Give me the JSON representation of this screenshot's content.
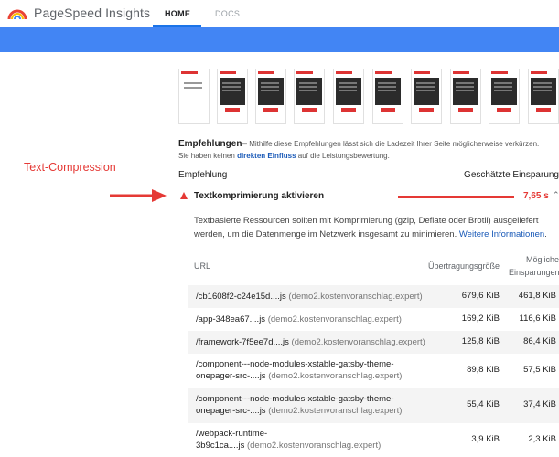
{
  "app": {
    "brand": "PageSpeed Insights",
    "tabs": [
      {
        "label": "HOME",
        "active": true
      },
      {
        "label": "DOCS",
        "active": false
      }
    ],
    "accent_color": "#4285f4"
  },
  "annotation": {
    "label": "Text-Compression",
    "color": "#e53935"
  },
  "opportunities": {
    "title": "Empfehlungen",
    "description": "— Mithilfe diese Empfehlungen lässt sich die Ladezeit Ihrer Seite möglicherweise verkürzen.",
    "description2_prefix": "Sie haben keinen ",
    "description2_link": "direkten Einfluss",
    "description2_suffix": " auf die Leistungsbewertung.",
    "col_left": "Empfehlung",
    "col_right": "Geschätzte Einsparung"
  },
  "audit": {
    "title": "Textkomprimierung aktivieren",
    "savings": "7,65 s",
    "severity_color": "#e53935",
    "description": "Textbasierte Ressourcen sollten mit Komprimierung (gzip, Deflate oder Brotli) ausgeliefert werden, um die Datenmenge im Netzwerk insgesamt zu minimieren. ",
    "link": "Weitere Informationen",
    "link_suffix": "."
  },
  "table": {
    "headers": {
      "url": "URL",
      "size": "Übertragungsgröße",
      "savings_line1": "Mögliche",
      "savings_line2": "Einsparungen"
    },
    "rows": [
      {
        "url": "/cb1608f2-c24e15d....js",
        "url2": "",
        "host": "(demo2.kostenvoranschlag.expert)",
        "size": "679,6 KiB",
        "savings": "461,8 KiB"
      },
      {
        "url": "/app-348ea67....js",
        "url2": "",
        "host": "(demo2.kostenvoranschlag.expert)",
        "size": "169,2 KiB",
        "savings": "116,6 KiB"
      },
      {
        "url": "/framework-7f5ee7d....js",
        "url2": "",
        "host": "(demo2.kostenvoranschlag.expert)",
        "size": "125,8 KiB",
        "savings": "86,4 KiB"
      },
      {
        "url": "/component---node-modules-xstable-gatsby-theme-",
        "url2": "onepager-src-....js",
        "host": "(demo2.kostenvoranschlag.expert)",
        "size": "89,8 KiB",
        "savings": "57,5 KiB"
      },
      {
        "url": "/component---node-modules-xstable-gatsby-theme-",
        "url2": "onepager-src-....js",
        "host": "(demo2.kostenvoranschlag.expert)",
        "size": "55,4 KiB",
        "savings": "37,4 KiB"
      },
      {
        "url": "/webpack-runtime-",
        "url2": "3b9c1ca....js",
        "host": "(demo2.kostenvoranschlag.expert)",
        "size": "3,9 KiB",
        "savings": "2,3 KiB"
      }
    ]
  }
}
